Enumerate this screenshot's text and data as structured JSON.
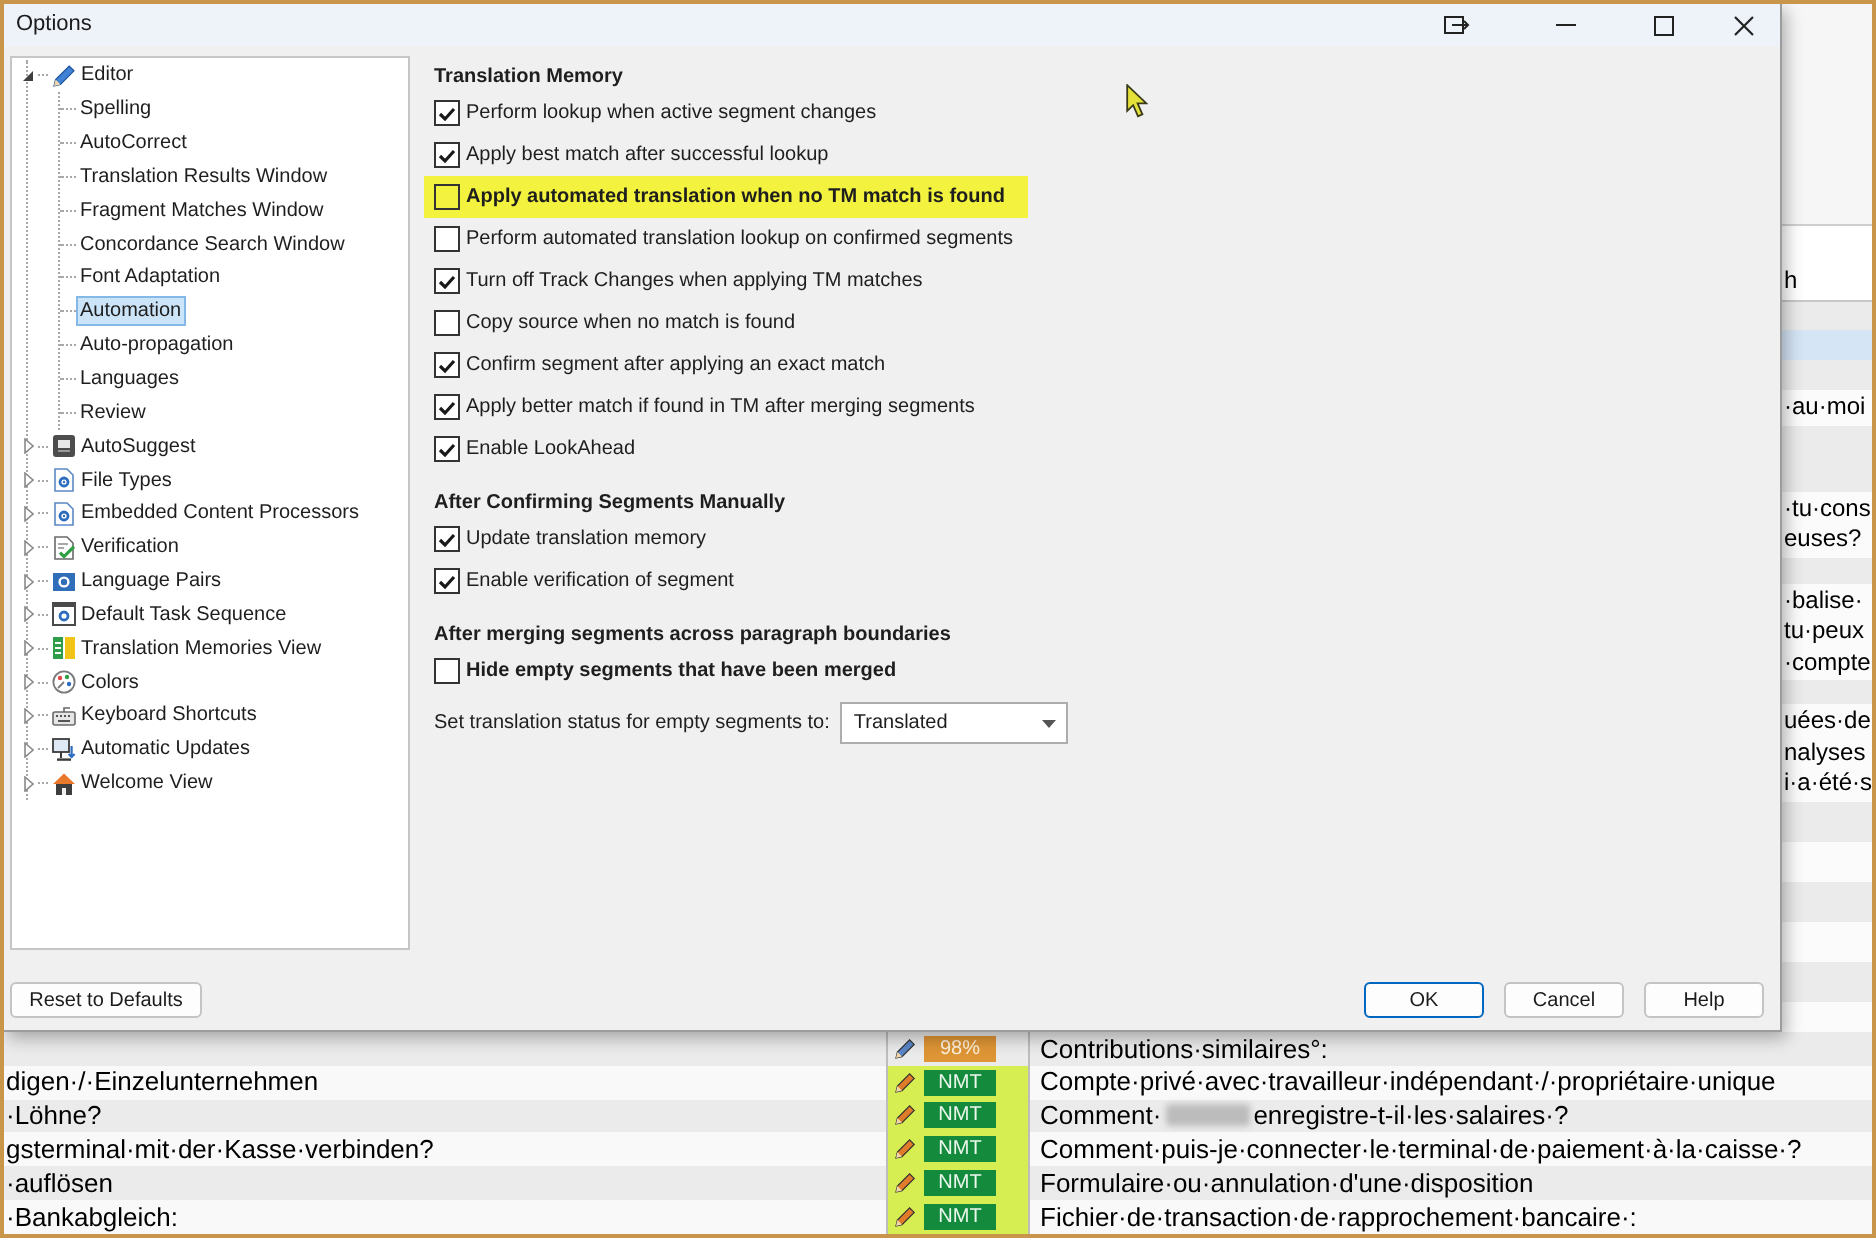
{
  "window": {
    "title": "Options"
  },
  "tree": [
    {
      "label": "Editor",
      "expanded": true,
      "selected": false,
      "children": [
        {
          "label": "Spelling",
          "selected": false
        },
        {
          "label": "AutoCorrect",
          "selected": false
        },
        {
          "label": "Translation Results Window",
          "selected": false
        },
        {
          "label": "Fragment Matches Window",
          "selected": false
        },
        {
          "label": "Concordance Search Window",
          "selected": false
        },
        {
          "label": "Font Adaptation",
          "selected": false
        },
        {
          "label": "Automation",
          "selected": true
        },
        {
          "label": "Auto-propagation",
          "selected": false
        },
        {
          "label": "Languages",
          "selected": false
        },
        {
          "label": "Review",
          "selected": false
        }
      ]
    },
    {
      "label": "AutoSuggest",
      "expanded": false,
      "selected": false
    },
    {
      "label": "File Types",
      "expanded": false,
      "selected": false
    },
    {
      "label": "Embedded Content Processors",
      "expanded": false,
      "selected": false
    },
    {
      "label": "Verification",
      "expanded": false,
      "selected": false
    },
    {
      "label": "Language Pairs",
      "expanded": false,
      "selected": false
    },
    {
      "label": "Default Task Sequence",
      "expanded": false,
      "selected": false
    },
    {
      "label": "Translation Memories View",
      "expanded": false,
      "selected": false
    },
    {
      "label": "Colors",
      "expanded": false,
      "selected": false
    },
    {
      "label": "Keyboard Shortcuts",
      "expanded": false,
      "selected": false
    },
    {
      "label": "Automatic Updates",
      "expanded": false,
      "selected": false
    },
    {
      "label": "Welcome View",
      "expanded": false,
      "selected": false
    }
  ],
  "sections": [
    {
      "heading": "Translation Memory",
      "options": [
        {
          "label": "Perform lookup when active segment changes",
          "checked": true,
          "highlighted": false,
          "emphasized": false
        },
        {
          "label": "Apply best match after successful lookup",
          "checked": true,
          "highlighted": false,
          "emphasized": false
        },
        {
          "label": "Apply automated translation when no TM match is found",
          "checked": false,
          "highlighted": true,
          "emphasized": true
        },
        {
          "label": "Perform automated translation lookup on confirmed segments",
          "checked": false,
          "highlighted": false,
          "emphasized": false
        },
        {
          "label": "Turn off Track Changes when applying TM matches",
          "checked": true,
          "highlighted": false,
          "emphasized": false
        },
        {
          "label": "Copy source when no match is found",
          "checked": false,
          "highlighted": false,
          "emphasized": false
        },
        {
          "label": "Confirm segment after applying an exact match",
          "checked": true,
          "highlighted": false,
          "emphasized": false
        },
        {
          "label": "Apply better match if found in TM after merging segments",
          "checked": true,
          "highlighted": false,
          "emphasized": false
        },
        {
          "label": "Enable LookAhead",
          "checked": true,
          "highlighted": false,
          "emphasized": false
        }
      ]
    },
    {
      "heading": "After Confirming Segments Manually",
      "options": [
        {
          "label": "Update translation memory",
          "checked": true,
          "highlighted": false,
          "emphasized": false
        },
        {
          "label": "Enable verification of segment",
          "checked": true,
          "highlighted": false,
          "emphasized": false
        }
      ]
    },
    {
      "heading": "After merging segments across paragraph boundaries",
      "options": [
        {
          "label": "Hide empty segments that have been merged",
          "checked": false,
          "highlighted": false,
          "emphasized": true
        }
      ],
      "setting": {
        "label": "Set translation status for empty segments to:",
        "value": "Translated"
      }
    }
  ],
  "footer": {
    "left": [
      {
        "label": "Reset to Defaults",
        "default": false
      }
    ],
    "right": [
      {
        "label": "OK",
        "default": true
      },
      {
        "label": "Cancel",
        "default": false
      },
      {
        "label": "Help",
        "default": false
      }
    ]
  },
  "editor": {
    "column_header": "h",
    "side_rows": [
      {
        "selected": true
      },
      {
        "selected": false,
        "lines": [
          "·au·moi"
        ]
      },
      {
        "selected": false,
        "lines": [
          "·tu·cons",
          "euses?"
        ]
      },
      {
        "selected": false,
        "lines": [
          "·balise·",
          "tu·peux",
          "·compte"
        ]
      },
      {
        "selected": false,
        "lines": [
          "uées·de",
          "nalyses",
          "i·a·été·s"
        ]
      }
    ],
    "rows": [
      {
        "kind": "fuzzy",
        "badge": "98%",
        "target": "Contributions·similaires°:",
        "redacted": false
      },
      {
        "source": "digen·/·Einzelunternehmen",
        "kind": "nmt",
        "badge": "NMT",
        "target": "Compte·privé·avec·travailleur·indépendant·/·propriétaire·unique",
        "redacted": false
      },
      {
        "source": "·Löhne?",
        "kind": "nmt",
        "badge": "NMT",
        "target": "Comment·",
        "redacted": true,
        "target_end": "enregistre-t-il·les·salaires·?"
      },
      {
        "source": "gsterminal·mit·der·Kasse·verbinden?",
        "kind": "nmt",
        "badge": "NMT",
        "target": "Comment·puis-je·connecter·le·terminal·de·paiement·à·la·caisse·?",
        "redacted": false
      },
      {
        "source": "·auflösen",
        "kind": "nmt",
        "badge": "NMT",
        "target": "Formulaire·ou·annulation·d'une·disposition",
        "redacted": false
      },
      {
        "source": "·Bankabgleich:",
        "kind": "nmt",
        "badge": "NMT",
        "target": "Fichier·de·transaction·de·rapprochement·bancaire·:",
        "redacted": false
      }
    ]
  }
}
